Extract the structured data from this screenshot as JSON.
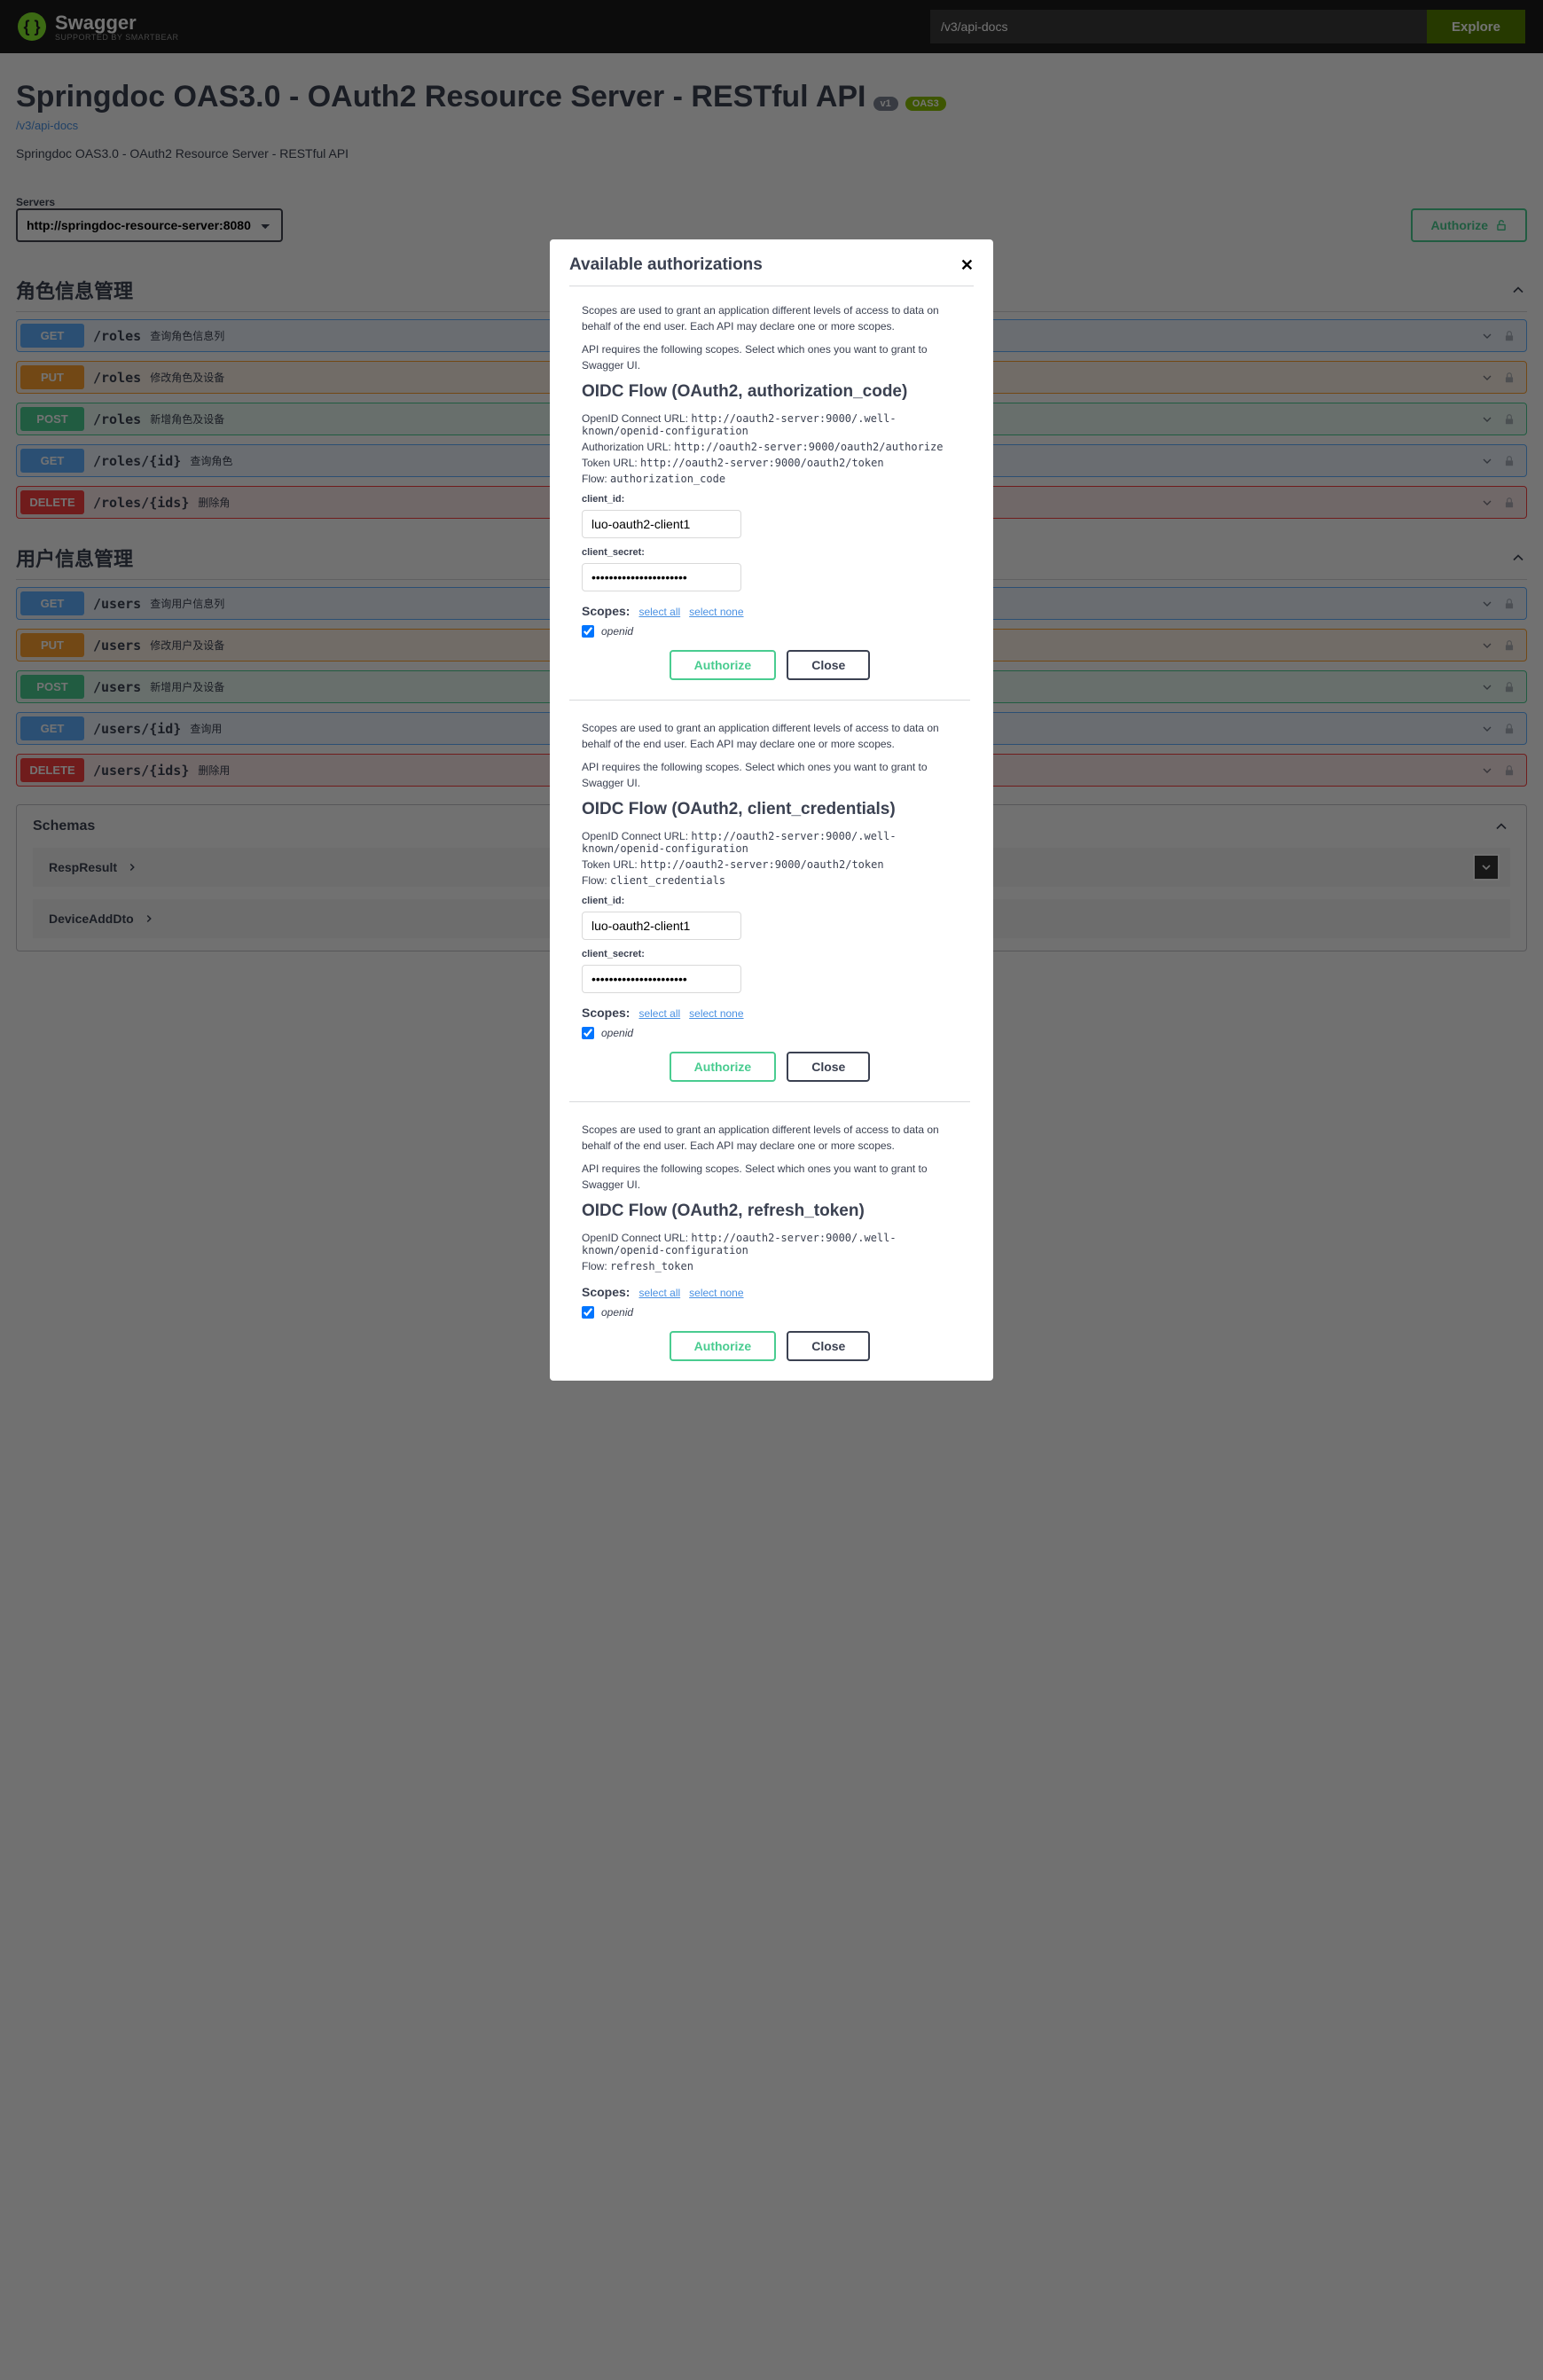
{
  "topbar": {
    "brand": "Swagger",
    "brand_sub": "SUPPORTED BY SMARTBEAR",
    "explore_value": "/v3/api-docs",
    "explore_btn": "Explore"
  },
  "header": {
    "title": "Springdoc OAS3.0 - OAuth2 Resource Server - RESTful API",
    "badge_v1": "v1",
    "badge_oas": "OAS3",
    "link": "/v3/api-docs",
    "desc": "Springdoc OAS3.0 - OAuth2 Resource Server - RESTful API"
  },
  "servers": {
    "label": "Servers",
    "selected": "http://springdoc-resource-server:8080",
    "authorize_btn": "Authorize"
  },
  "tags": [
    {
      "name": "角色信息管理",
      "ops": [
        {
          "method": "GET",
          "path": "/roles",
          "summary": "查询角色信息列",
          "cls": "get"
        },
        {
          "method": "PUT",
          "path": "/roles",
          "summary": "修改角色及设备",
          "cls": "put"
        },
        {
          "method": "POST",
          "path": "/roles",
          "summary": "新增角色及设备",
          "cls": "post"
        },
        {
          "method": "GET",
          "path": "/roles/{id}",
          "summary": "查询角色",
          "cls": "get"
        },
        {
          "method": "DELETE",
          "path": "/roles/{ids}",
          "summary": "删除角",
          "cls": "delete"
        }
      ]
    },
    {
      "name": "用户信息管理",
      "ops": [
        {
          "method": "GET",
          "path": "/users",
          "summary": "查询用户信息列",
          "cls": "get"
        },
        {
          "method": "PUT",
          "path": "/users",
          "summary": "修改用户及设备",
          "cls": "put"
        },
        {
          "method": "POST",
          "path": "/users",
          "summary": "新增用户及设备",
          "cls": "post"
        },
        {
          "method": "GET",
          "path": "/users/{id}",
          "summary": "查询用",
          "cls": "get"
        },
        {
          "method": "DELETE",
          "path": "/users/{ids}",
          "summary": "删除用",
          "cls": "delete"
        }
      ]
    }
  ],
  "schemas": {
    "title": "Schemas",
    "items": [
      "RespResult",
      "DeviceAddDto"
    ]
  },
  "modal": {
    "title": "Available authorizations",
    "desc1": "Scopes are used to grant an application different levels of access to data on behalf of the end user. Each API may declare one or more scopes.",
    "desc2": "API requires the following scopes. Select which ones you want to grant to Swagger UI.",
    "client_id_label": "client_id:",
    "client_secret_label": "client_secret:",
    "scopes_label": "Scopes:",
    "select_all": "select all",
    "select_none": "select none",
    "scope_openid": "openid",
    "authorize": "Authorize",
    "close": "Close",
    "blocks": [
      {
        "flow_title": "OIDC Flow (OAuth2, authorization_code)",
        "lines": [
          {
            "label": "OpenID Connect URL:",
            "val": "http://oauth2-server:9000/.well-known/openid-configuration"
          },
          {
            "label": "Authorization URL:",
            "val": "http://oauth2-server:9000/oauth2/authorize"
          },
          {
            "label": "Token URL:",
            "val": "http://oauth2-server:9000/oauth2/token"
          },
          {
            "label": "Flow:",
            "val": "authorization_code"
          }
        ],
        "has_inputs": true,
        "client_id": "luo-oauth2-client1",
        "client_secret": "••••••••••••••••••••••"
      },
      {
        "flow_title": "OIDC Flow (OAuth2, client_credentials)",
        "lines": [
          {
            "label": "OpenID Connect URL:",
            "val": "http://oauth2-server:9000/.well-known/openid-configuration"
          },
          {
            "label": "Token URL:",
            "val": "http://oauth2-server:9000/oauth2/token"
          },
          {
            "label": "Flow:",
            "val": "client_credentials"
          }
        ],
        "has_inputs": true,
        "client_id": "luo-oauth2-client1",
        "client_secret": "••••••••••••••••••••••"
      },
      {
        "flow_title": "OIDC Flow (OAuth2, refresh_token)",
        "lines": [
          {
            "label": "OpenID Connect URL:",
            "val": "http://oauth2-server:9000/.well-known/openid-configuration"
          },
          {
            "label": "Flow:",
            "val": "refresh_token"
          }
        ],
        "has_inputs": false
      }
    ]
  }
}
